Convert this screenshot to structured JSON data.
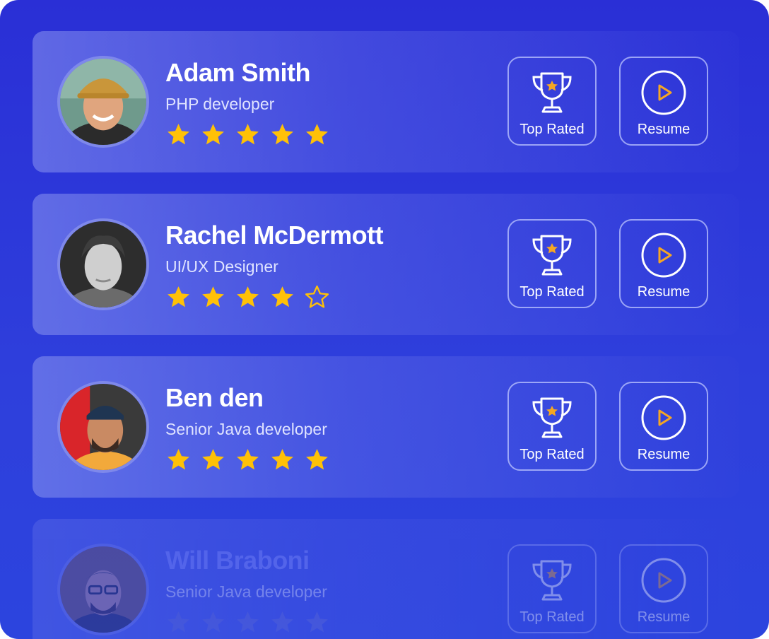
{
  "colors": {
    "background": "#2a2fd6",
    "star_filled": "#ffc107",
    "icon_accent": "#f5a623",
    "text_primary": "#ffffff"
  },
  "candidates": [
    {
      "name": "Adam Smith",
      "role": "PHP developer",
      "rating": 5,
      "top_rated_label": "Top Rated",
      "resume_label": "Resume",
      "icons": {
        "trophy": "trophy-icon",
        "play": "play-circle-icon"
      }
    },
    {
      "name": "Rachel McDermott",
      "role": "UI/UX Designer",
      "rating": 4,
      "top_rated_label": "Top Rated",
      "resume_label": "Resume",
      "icons": {
        "trophy": "trophy-icon",
        "play": "play-circle-icon"
      }
    },
    {
      "name": "Ben den",
      "role": "Senior Java developer",
      "rating": 5,
      "top_rated_label": "Top Rated",
      "resume_label": "Resume",
      "icons": {
        "trophy": "trophy-icon",
        "play": "play-circle-icon"
      }
    },
    {
      "name": "Will Braboni",
      "role": "Senior Java developer",
      "rating": 5,
      "top_rated_label": "Top Rated",
      "resume_label": "Resume",
      "icons": {
        "trophy": "trophy-icon",
        "play": "play-circle-icon"
      }
    }
  ]
}
